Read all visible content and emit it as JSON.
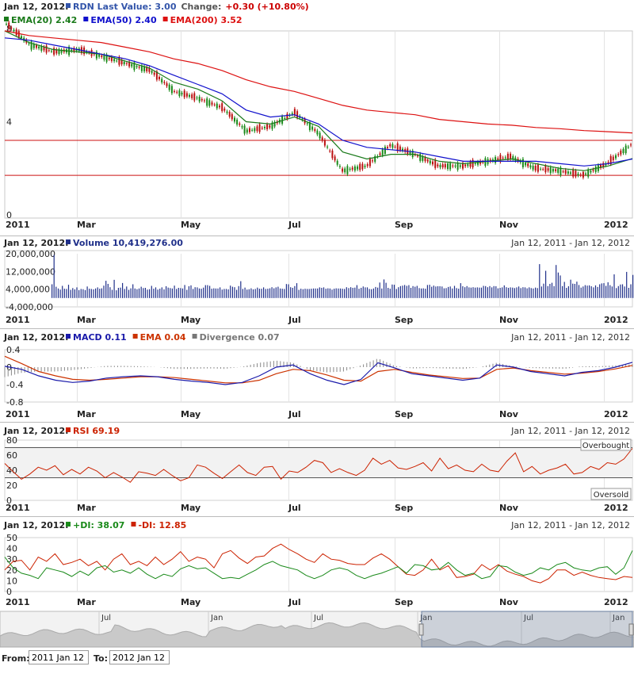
{
  "date_label": "Jan 12, 2012:",
  "range_label": "Jan 12, 2011 - Jan 12, 2012",
  "month_labels": [
    "2011",
    "Mar",
    "May",
    "Jul",
    "Sep",
    "Nov",
    "2012"
  ],
  "price_panel": {
    "legend": [
      {
        "text": "RDN Last Value: 3.00",
        "color": "#3355aa"
      },
      {
        "text": "EMA(20) 2.42",
        "color": "#1a7a1a"
      },
      {
        "text": "EMA(50) 2.40",
        "color": "#1010cc"
      },
      {
        "text": "EMA(200) 3.52",
        "color": "#dd1111"
      }
    ],
    "change_label": "Change:",
    "change_value": "+0.30 (+10.80%)"
  },
  "volume_panel": {
    "legend_text": "Volume 10,419,276.00",
    "color": "#20308a"
  },
  "macd_panel": {
    "legend": [
      {
        "text": "MACD 0.11",
        "color": "#1a1aaa"
      },
      {
        "text": "EMA 0.04",
        "color": "#cc3300"
      },
      {
        "text": "Divergence 0.07",
        "color": "#777777"
      }
    ]
  },
  "rsi_panel": {
    "legend_text": "RSI 69.19",
    "color": "#cc2200",
    "overbought": "Overbought",
    "oversold": "Oversold"
  },
  "di_panel": {
    "legend": [
      {
        "text": "+DI: 38.07",
        "color": "#1a8a1a"
      },
      {
        "text": "-DI: 12.85",
        "color": "#cc2200"
      }
    ]
  },
  "navigator": {
    "labels": [
      "Jul",
      "Jan",
      "Jul",
      "Jan",
      "Jul",
      "Jan"
    ]
  },
  "range_inputs": {
    "from_label": "From:",
    "from_value": "2011 Jan 12",
    "to_label": "To:",
    "to_value": "2012 Jan 12"
  },
  "chart_data": [
    {
      "type": "line",
      "title": "RDN",
      "x": [
        "2011-01-12",
        "2011-02-01",
        "2011-02-15",
        "2011-03-01",
        "2011-03-15",
        "2011-04-01",
        "2011-04-15",
        "2011-05-01",
        "2011-05-15",
        "2011-06-01",
        "2011-06-15",
        "2011-07-01",
        "2011-07-15",
        "2011-08-01",
        "2011-08-10",
        "2011-08-25",
        "2011-09-01",
        "2011-09-15",
        "2011-10-01",
        "2011-10-15",
        "2011-11-01",
        "2011-11-10",
        "2011-11-25",
        "2011-12-01",
        "2011-12-15",
        "2012-01-01",
        "2012-01-12"
      ],
      "y_range": [
        0,
        8
      ],
      "y_ticks": [
        0,
        4,
        8
      ],
      "reference_lines": [
        3.2,
        1.7
      ],
      "series": [
        {
          "name": "RDN",
          "values": [
            8.2,
            7.3,
            7.0,
            7.1,
            6.8,
            6.5,
            6.2,
            5.3,
            5.0,
            4.6,
            3.6,
            3.8,
            4.4,
            3.5,
            1.9,
            2.1,
            3.0,
            2.6,
            2.1,
            2.1,
            2.3,
            2.5,
            2.0,
            1.9,
            1.7,
            2.2,
            3.0
          ]
        },
        {
          "name": "EMA(20)",
          "values": [
            7.9,
            7.4,
            7.1,
            7.0,
            6.9,
            6.6,
            6.3,
            5.7,
            5.4,
            4.9,
            4.0,
            3.9,
            4.2,
            3.8,
            2.7,
            2.4,
            2.6,
            2.6,
            2.3,
            2.2,
            2.3,
            2.4,
            2.2,
            2.0,
            1.9,
            2.1,
            2.42
          ]
        },
        {
          "name": "EMA(50)",
          "values": [
            7.6,
            7.5,
            7.3,
            7.1,
            6.9,
            6.7,
            6.4,
            6.0,
            5.6,
            5.2,
            4.5,
            4.2,
            4.3,
            3.9,
            3.2,
            2.9,
            2.8,
            2.7,
            2.5,
            2.3,
            2.3,
            2.3,
            2.3,
            2.2,
            2.1,
            2.2,
            2.4
          ]
        },
        {
          "name": "EMA(200)",
          "values": [
            7.9,
            7.7,
            7.6,
            7.5,
            7.4,
            7.2,
            7.0,
            6.7,
            6.5,
            6.2,
            5.8,
            5.5,
            5.3,
            5.0,
            4.7,
            4.5,
            4.4,
            4.3,
            4.1,
            4.0,
            3.9,
            3.85,
            3.75,
            3.7,
            3.62,
            3.57,
            3.52
          ]
        }
      ]
    },
    {
      "type": "bar",
      "title": "Volume",
      "y_range": [
        -4000000,
        20000000
      ],
      "y_ticks": [
        -4000000,
        4000000,
        12000000,
        20000000
      ],
      "y_tick_labels": [
        "-4,000,000",
        "4,000,000",
        "12,000,000",
        "20,000,000"
      ],
      "series": [
        {
          "name": "Volume",
          "values": [
            6200000,
            19500000,
            5100000,
            4300000,
            3800000,
            5500000,
            4200000,
            4100000,
            6000000,
            3700000,
            4500000,
            3900000,
            4800000,
            3600000,
            4100000,
            4000000,
            3600000,
            5200000,
            4200000,
            4100000,
            3900000,
            4300000,
            4800000,
            4200000,
            4400000,
            5600000,
            7800000,
            6400000,
            4900000,
            3700000,
            8200000,
            3500000,
            4600000,
            4700000,
            6800000,
            4100000,
            5200000,
            3700000,
            4400000,
            6200000,
            4300000,
            4000000,
            4300000,
            5100000,
            4500000,
            4600000,
            3800000,
            4000000,
            5500000,
            4200000,
            4800000,
            3800000,
            4200000,
            4800000,
            3900000,
            5300000,
            4700000,
            4500000,
            4300000,
            5600000,
            4100000,
            4600000,
            4500000,
            4300000,
            5900000,
            3700000,
            5300000,
            5700000,
            4100000,
            4900000,
            4800000,
            4300000,
            4200000,
            4700000,
            5800000,
            5800000,
            5500000,
            4200000,
            4400000,
            4300000,
            4300000,
            4800000,
            3800000,
            4100000,
            4100000,
            3900000,
            5600000,
            5100000,
            4900000,
            3700000,
            5400000,
            7600000,
            4100000,
            4700000,
            3800000,
            4000000,
            4400000,
            3900000,
            4100000,
            4700000,
            4200000,
            4200000,
            4800000,
            4100000,
            4200000,
            4400000,
            4900000,
            4400000,
            4800000,
            5100000,
            4300000,
            4200000,
            4100000,
            6300000,
            6200000,
            4900000,
            4600000,
            5400000,
            6700000,
            3700000,
            4200000,
            4000000,
            4200000,
            4100000,
            4100000,
            4200000,
            4300000,
            4300000,
            4300000,
            4800000,
            4600000,
            4800000,
            4200000,
            4400000,
            4300000,
            3800000,
            4200000,
            4400000,
            4300000,
            4300000,
            4200000,
            4100000,
            4900000,
            4500000,
            4900000,
            4600000,
            4700000,
            5800000,
            4200000,
            4600000,
            5200000,
            4800000,
            4800000,
            4100000,
            4000000,
            4300000,
            5000000,
            4700000,
            7000000,
            4300000,
            8400000,
            6900000,
            4600000,
            4200000,
            6100000,
            6000000,
            4100000,
            4900000,
            5400000,
            5600000,
            5900000,
            5500000,
            5800000,
            4600000,
            5400000,
            5100000,
            5500000,
            4500000,
            4300000,
            4400000,
            4200000,
            5900000,
            6000000,
            5100000,
            5600000,
            5200000,
            5300000,
            5300000,
            5200000,
            4400000,
            4500000,
            5000000,
            5200000,
            4300000,
            5500000,
            4500000,
            4200000,
            6700000,
            5300000,
            4900000,
            5400000,
            4800000,
            4700000,
            4900000,
            4700000,
            4800000,
            4700000,
            4700000,
            5500000,
            5400000,
            4900000,
            5400000,
            4800000,
            5400000,
            5300000,
            4400000,
            4600000,
            4800000,
            5700000,
            4900000,
            4600000,
            4800000,
            4700000,
            4500000,
            4800000,
            5200000,
            4500000,
            4900000,
            4800000,
            4400000,
            4800000,
            4500000,
            4300000,
            4700000,
            4500000,
            15300000,
            5200000,
            6500000,
            12300000,
            5400000,
            6400000,
            6900000,
            5400000,
            14900000,
            11500000,
            10200000,
            5400000,
            7300000,
            4600000,
            5300000,
            8300000,
            6500000,
            6400000,
            7400000,
            5900000,
            4700000,
            5200000,
            5800000,
            5600000,
            5700000,
            5300000,
            4800000,
            5700000,
            5000000,
            6200000,
            6600000,
            6700000,
            5500000,
            7100000,
            5800000,
            5200000,
            10700000,
            4500000,
            5400000,
            6100000,
            6200000,
            5200000,
            11800000,
            4600000,
            6200000,
            10419276
          ]
        }
      ]
    },
    {
      "type": "line",
      "title": "MACD",
      "y_range": [
        -0.8,
        0.4
      ],
      "y_ticks": [
        -0.8,
        -0.4,
        0,
        0.4
      ],
      "series": [
        {
          "name": "MACD",
          "values": [
            0.02,
            -0.05,
            -0.2,
            -0.3,
            -0.35,
            -0.32,
            -0.25,
            -0.22,
            -0.2,
            -0.22,
            -0.28,
            -0.32,
            -0.35,
            -0.4,
            -0.35,
            -0.2,
            0.0,
            0.05,
            -0.15,
            -0.3,
            -0.4,
            -0.28,
            0.1,
            -0.02,
            -0.15,
            -0.2,
            -0.25,
            -0.3,
            -0.25,
            0.05,
            0.0,
            -0.1,
            -0.15,
            -0.2,
            -0.12,
            -0.08,
            0.0,
            0.11
          ]
        },
        {
          "name": "EMA",
          "values": [
            0.25,
            0.08,
            -0.1,
            -0.2,
            -0.28,
            -0.3,
            -0.28,
            -0.25,
            -0.22,
            -0.22,
            -0.24,
            -0.28,
            -0.32,
            -0.36,
            -0.36,
            -0.3,
            -0.15,
            -0.05,
            -0.08,
            -0.18,
            -0.3,
            -0.32,
            -0.1,
            -0.05,
            -0.12,
            -0.18,
            -0.22,
            -0.26,
            -0.25,
            -0.05,
            -0.02,
            -0.08,
            -0.12,
            -0.16,
            -0.14,
            -0.1,
            -0.04,
            0.04
          ]
        },
        {
          "name": "Divergence",
          "values": [
            -0.23,
            -0.13,
            -0.1,
            -0.1,
            -0.07,
            -0.02,
            0.03,
            0.03,
            0.02,
            0.0,
            -0.04,
            -0.04,
            -0.03,
            -0.04,
            0.01,
            0.1,
            0.15,
            0.1,
            -0.07,
            -0.12,
            -0.1,
            0.04,
            0.2,
            0.03,
            -0.03,
            -0.02,
            -0.03,
            -0.04,
            0.0,
            0.1,
            0.02,
            -0.02,
            -0.03,
            -0.04,
            0.02,
            0.02,
            0.04,
            0.07
          ]
        }
      ]
    },
    {
      "type": "line",
      "title": "RSI",
      "y_range": [
        0,
        80
      ],
      "y_ticks": [
        0,
        20,
        40,
        60,
        80
      ],
      "reference_lines": [
        70,
        30
      ],
      "series": [
        {
          "name": "RSI",
          "values": [
            49,
            38,
            28,
            35,
            44,
            40,
            46,
            34,
            41,
            35,
            44,
            39,
            30,
            37,
            31,
            24,
            38,
            36,
            33,
            41,
            33,
            26,
            30,
            47,
            44,
            36,
            29,
            38,
            47,
            37,
            33,
            44,
            45,
            28,
            39,
            37,
            44,
            53,
            50,
            37,
            42,
            37,
            33,
            40,
            56,
            48,
            53,
            43,
            41,
            45,
            50,
            39,
            56,
            42,
            47,
            40,
            38,
            48,
            40,
            38,
            52,
            63,
            38,
            45,
            35,
            40,
            43,
            48,
            35,
            37,
            45,
            41,
            50,
            48,
            55,
            69
          ]
        }
      ]
    },
    {
      "type": "line",
      "title": "DMI",
      "y_range": [
        0,
        50
      ],
      "y_ticks": [
        0,
        10,
        20,
        30,
        40,
        50
      ],
      "series": [
        {
          "name": "+DI",
          "values": [
            32,
            22,
            17,
            15,
            12,
            22,
            20,
            18,
            14,
            19,
            15,
            22,
            24,
            18,
            20,
            17,
            22,
            16,
            12,
            16,
            14,
            21,
            24,
            21,
            22,
            17,
            12,
            13,
            12,
            16,
            20,
            25,
            28,
            24,
            22,
            20,
            15,
            12,
            15,
            20,
            22,
            20,
            15,
            12,
            15,
            17,
            20,
            23,
            17,
            25,
            24,
            20,
            21,
            27,
            20,
            15,
            17,
            12,
            14,
            24,
            23,
            18,
            15,
            17,
            22,
            20,
            25,
            27,
            22,
            20,
            19,
            22,
            23,
            16,
            22,
            38
          ]
        },
        {
          "name": "-DI",
          "values": [
            20,
            28,
            29,
            20,
            32,
            28,
            35,
            25,
            27,
            30,
            24,
            28,
            20,
            30,
            35,
            25,
            28,
            24,
            32,
            25,
            30,
            37,
            28,
            32,
            30,
            22,
            35,
            38,
            31,
            26,
            32,
            33,
            40,
            44,
            39,
            35,
            30,
            27,
            35,
            30,
            29,
            26,
            25,
            25,
            31,
            35,
            30,
            23,
            16,
            15,
            20,
            30,
            20,
            24,
            13,
            14,
            16,
            25,
            20,
            25,
            19,
            16,
            14,
            10,
            8,
            12,
            20,
            20,
            15,
            18,
            15,
            13,
            12,
            11,
            14,
            13
          ]
        }
      ]
    }
  ]
}
